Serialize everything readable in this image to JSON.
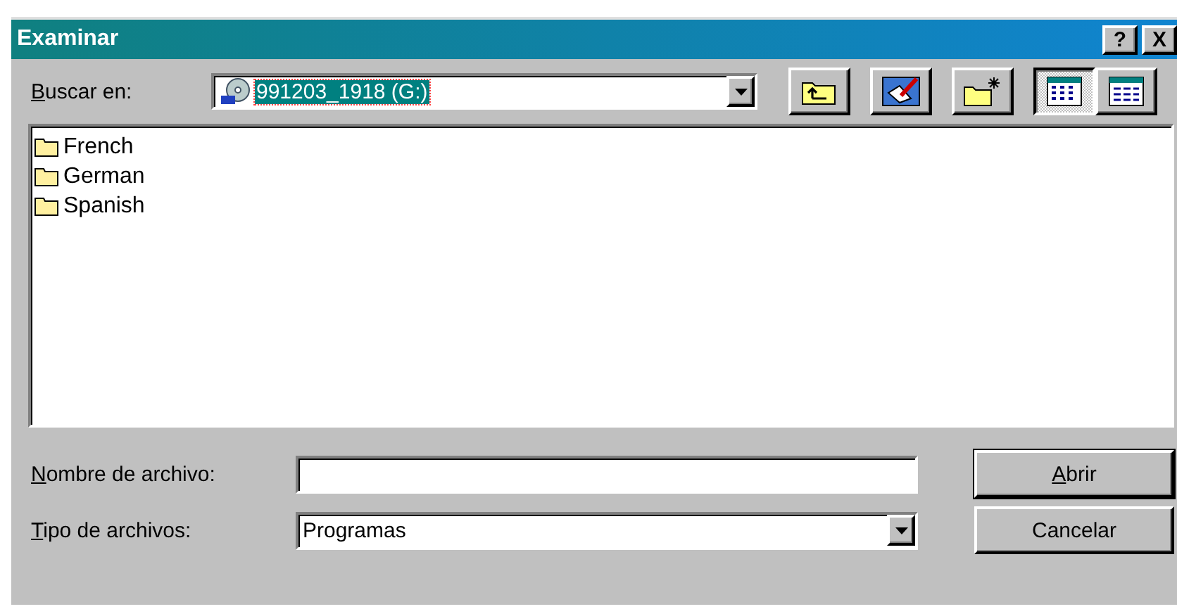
{
  "window": {
    "title": "Examinar",
    "help_button": "?",
    "close_button": "X"
  },
  "look_in": {
    "label": "Buscar en:",
    "value": "991203_1918 (G:)"
  },
  "toolbar": [
    {
      "kind": "up"
    },
    {
      "kind": "desktop"
    },
    {
      "kind": "new-folder"
    },
    {
      "kind": "list-view",
      "selected": true
    },
    {
      "kind": "details-view",
      "selected": false
    }
  ],
  "files": [
    {
      "name": "French"
    },
    {
      "name": "German"
    },
    {
      "name": "Spanish"
    }
  ],
  "file_name": {
    "label": "Nombre de archivo:"
  },
  "file_type": {
    "label": "Tipo de archivos:",
    "value": "Programas"
  },
  "buttons": [
    {
      "label": "Abrir",
      "default": true
    },
    {
      "label": "Cancelar",
      "default": false
    }
  ]
}
